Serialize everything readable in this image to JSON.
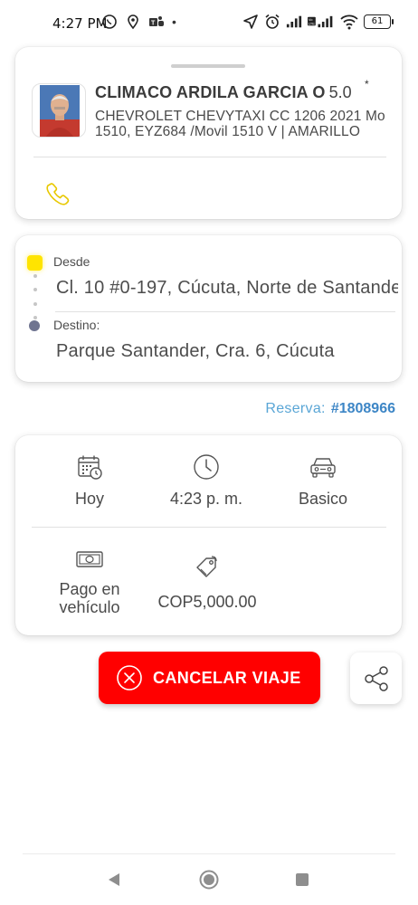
{
  "status_bar": {
    "time": "4:27 PM",
    "battery": "61",
    "left_icons": [
      "whatsapp-icon",
      "location-pin-icon",
      "teams-icon",
      "dot-icon"
    ],
    "right_icons": [
      "navigation-arrow-icon",
      "alarm-icon",
      "signal-icon",
      "volte-signal-icon",
      "wifi-icon",
      "battery-icon"
    ]
  },
  "driver": {
    "name": "CLIMACO ARDILA GARCIA O",
    "rating": "5.0",
    "rating_star": "*",
    "vehicle_line1": "CHEVROLET CHEVYTAXI CC 1206 2021 Mo",
    "vehicle_line2": "1510, EYZ684 /Movil 1510 V | AMARILLO"
  },
  "route": {
    "origin_label": "Desde",
    "origin_address": "Cl. 10 #0-197, Cúcuta, Norte de Santander",
    "destination_label": "Destino:",
    "destination_address": "Parque Santander, Cra. 6, Cúcuta"
  },
  "reservation": {
    "label": "Reserva:",
    "id": "#1808966"
  },
  "details": {
    "date": "Hoy",
    "time": "4:23 p. m.",
    "service": "Basico",
    "payment": "Pago en vehículo",
    "price": "COP5,000.00"
  },
  "actions": {
    "cancel_label": "CANCELAR VIAJE"
  },
  "colors": {
    "accent_red": "#ff0000",
    "origin_yellow": "#ffe400",
    "destination_dot": "#6f7490",
    "reservation_blue": "#3d86c6",
    "phone_yellow": "#e8c800"
  }
}
